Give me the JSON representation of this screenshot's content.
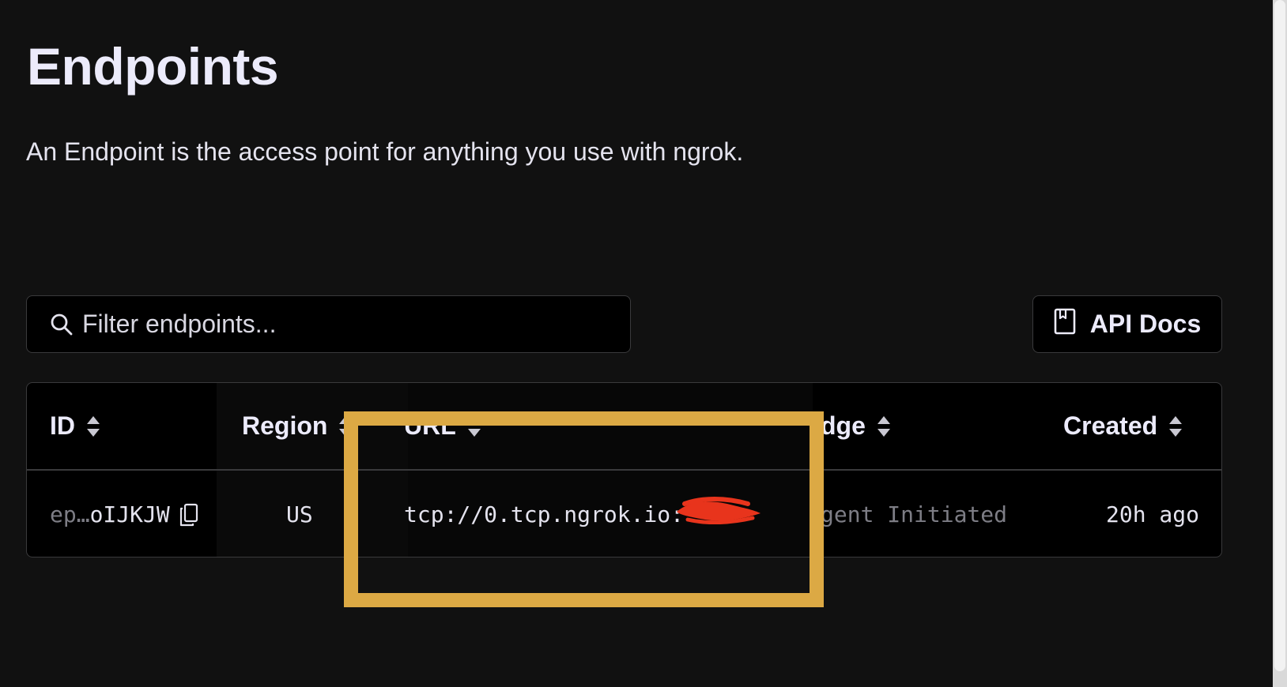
{
  "page": {
    "title": "Endpoints",
    "subtitle": "An Endpoint is the access point for anything you use with ngrok."
  },
  "search": {
    "placeholder": "Filter endpoints..."
  },
  "toolbar": {
    "api_docs_label": "API Docs"
  },
  "table": {
    "columns": [
      "ID",
      "Region",
      "URL",
      "Edge",
      "Created"
    ],
    "visible_headers": [
      "ID",
      "Region",
      "URL",
      "dge",
      "Created"
    ],
    "rows": [
      {
        "id_prefix": "ep…",
        "id_suffix": "oIJKJW",
        "region": "US",
        "url": "tcp://0.tcp.ngrok.io:",
        "edge": "gent Initiated",
        "created": "20h ago"
      }
    ]
  },
  "colors": {
    "background": "#111111",
    "surface": "#000000",
    "border": "#3a3a3c",
    "annotation_box": "#dca944",
    "redaction": "#e8341c"
  },
  "icons": {
    "search": "search-icon",
    "api_docs": "book-icon",
    "copy": "copy-icon",
    "sort": "sort-icon"
  }
}
